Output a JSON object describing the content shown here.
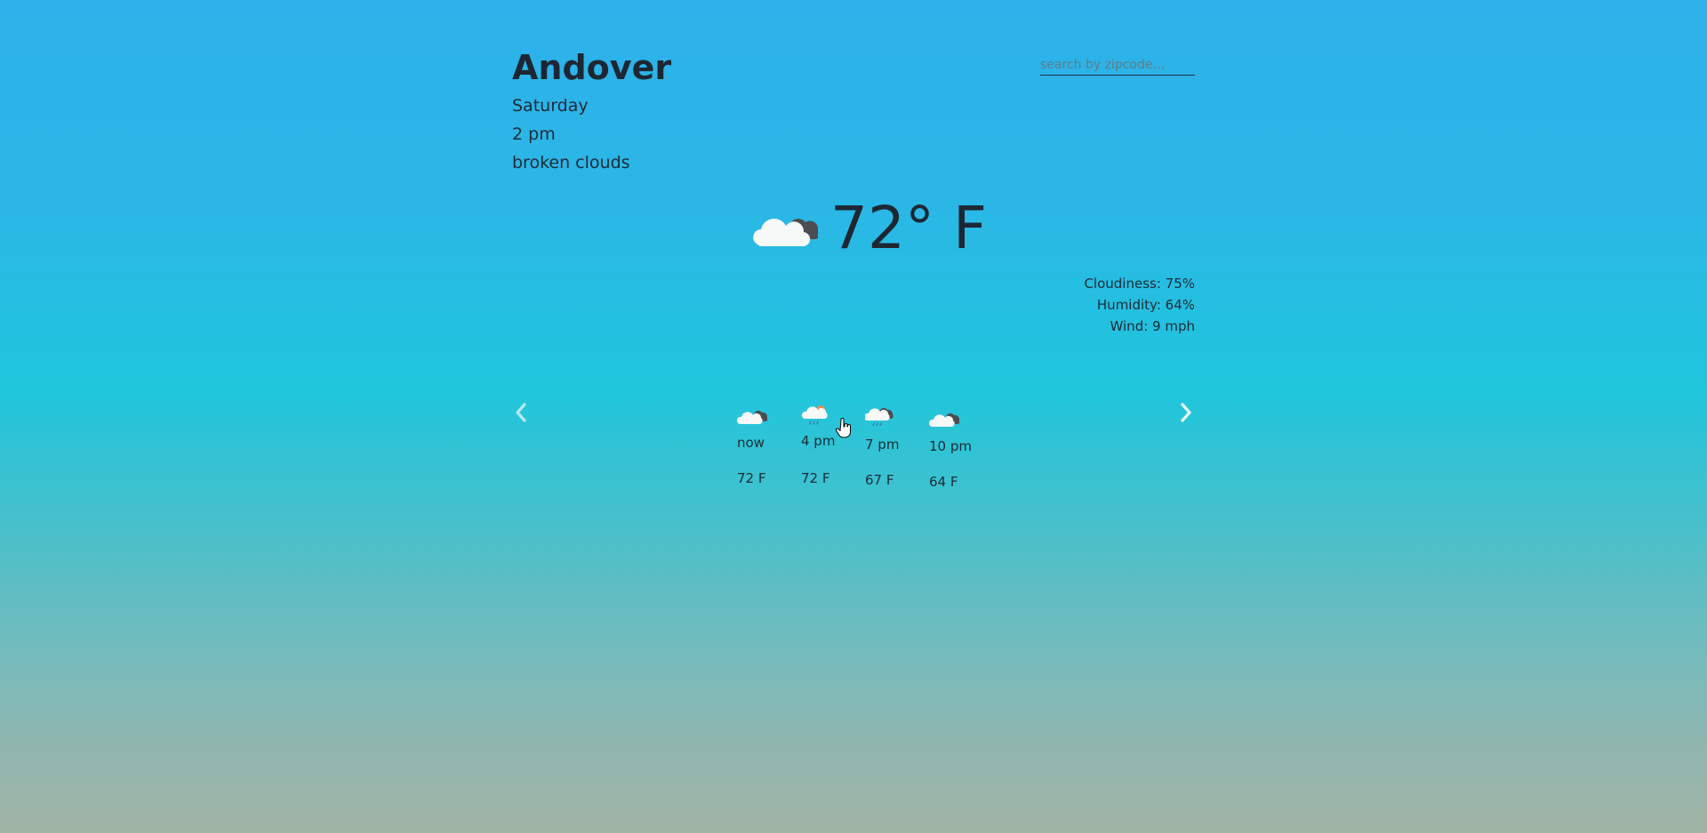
{
  "current": {
    "city": "Andover",
    "day": "Saturday",
    "time": "2 pm",
    "description": "broken clouds",
    "temperature": "72° F",
    "icon": "broken-clouds-icon"
  },
  "search": {
    "placeholder": "search by zipcode..."
  },
  "details": {
    "cloudiness": "Cloudiness: 75%",
    "humidity": "Humidity: 64%",
    "wind": "Wind: 9 mph"
  },
  "forecast": [
    {
      "label": "now",
      "temp": "72 F",
      "icon": "broken-clouds-icon"
    },
    {
      "label": "4 pm",
      "temp": "72 F",
      "icon": "sun-rain-icon"
    },
    {
      "label": "7 pm",
      "temp": "67 F",
      "icon": "rain-cloud-icon"
    },
    {
      "label": "10 pm",
      "temp": "64 F",
      "icon": "broken-clouds-icon"
    }
  ],
  "navigation": {
    "prev_icon": "chevron-left-icon",
    "next_icon": "chevron-right-icon"
  },
  "colors": {
    "text": "#1f2a36",
    "sky_top": "#2db1ea",
    "sky_bottom": "#a2b4a5"
  }
}
